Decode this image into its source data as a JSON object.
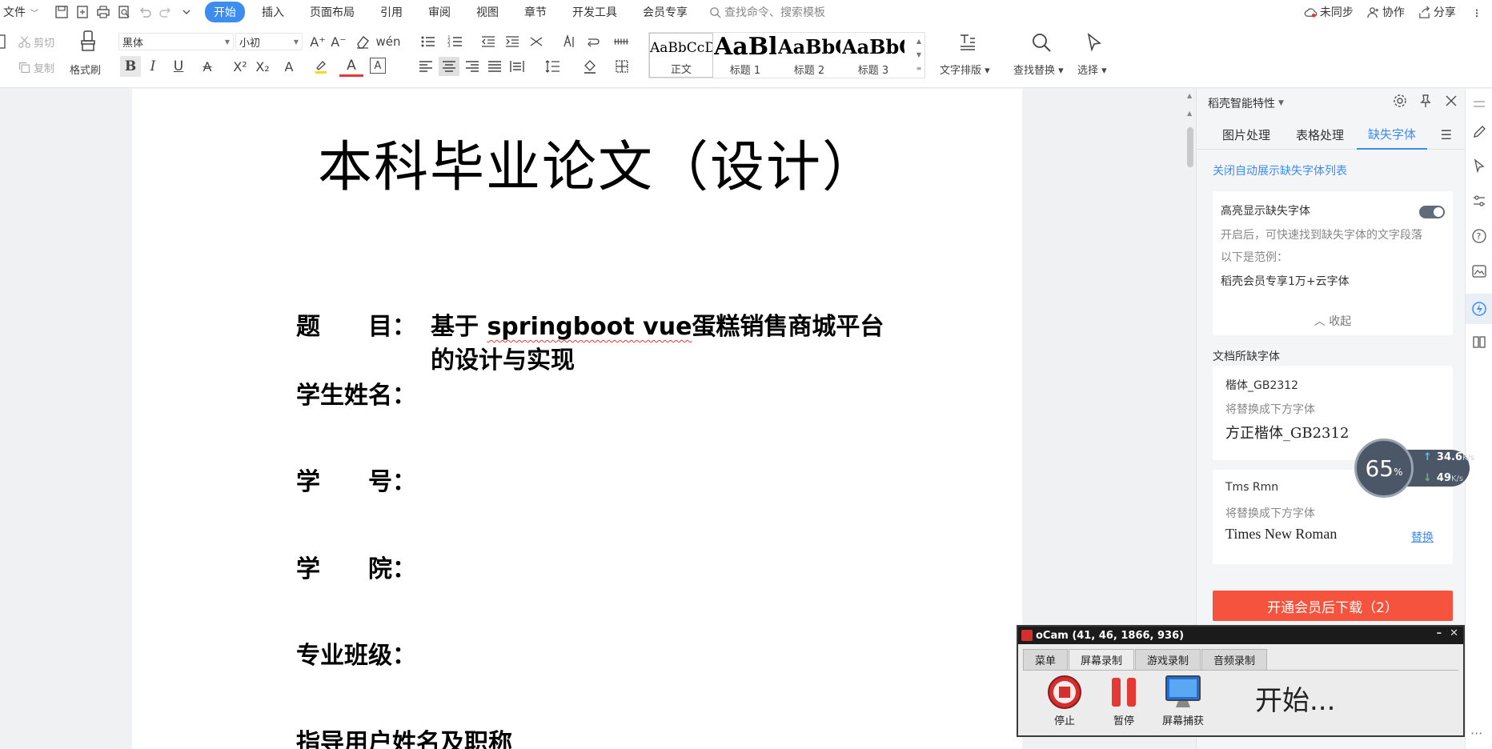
{
  "menubar": {
    "file_label": "文件",
    "tabs": [
      {
        "label": "开始",
        "active": true
      },
      {
        "label": "插入",
        "active": false
      },
      {
        "label": "页面布局",
        "active": false
      },
      {
        "label": "引用",
        "active": false
      },
      {
        "label": "审阅",
        "active": false
      },
      {
        "label": "视图",
        "active": false
      },
      {
        "label": "章节",
        "active": false
      },
      {
        "label": "开发工具",
        "active": false
      },
      {
        "label": "会员专享",
        "active": false
      }
    ],
    "search_placeholder": "查找命令、搜索模板",
    "right": {
      "sync": "未同步",
      "collab": "协作",
      "share": "分享"
    }
  },
  "ribbon": {
    "cut": "剪切",
    "copy": "复制",
    "format_painter": "格式刷",
    "font_name": "黑体",
    "font_size": "小初",
    "styles": [
      {
        "preview": "AaBbCcDd",
        "label": "正文"
      },
      {
        "preview": "AaBl",
        "label": "标题 1"
      },
      {
        "preview": "AaBbC",
        "label": "标题 2"
      },
      {
        "preview": "AaBbC",
        "label": "标题 3"
      }
    ],
    "text_layout": "文字排版",
    "find_replace": "查找替换",
    "select": "选择"
  },
  "document": {
    "title": "本科毕业论文（设计）",
    "fields": [
      {
        "label": "题　　目：",
        "value": "基于",
        "value_spell": "springboot vue",
        "value_rest": "蛋糕销售商城平台",
        "value_line2": "的设计与实现"
      },
      {
        "label": "学生姓名："
      },
      {
        "label": "学　　号："
      },
      {
        "label": "学　　院："
      },
      {
        "label": "专业班级："
      },
      {
        "label": "指导用户姓名及职称"
      }
    ]
  },
  "panel": {
    "title": "稻壳智能特性",
    "tabs": [
      "图片处理",
      "表格处理",
      "缺失字体"
    ],
    "active_tab": "缺失字体",
    "close_auto_link": "关闭自动展示缺失字体列表",
    "highlight": {
      "title": "高亮显示缺失字体",
      "desc": "开启后，可快速找到缺失字体的文字段落",
      "example_label": "以下是范例：",
      "example": "稻壳会员专享1万+云字体",
      "collapse": "收起"
    },
    "missing_title": "文档所缺字体",
    "fonts": [
      {
        "name": "楷体_GB2312",
        "hint": "将替换成下方字体",
        "replacement": "方正楷体_GB2312",
        "action": ""
      },
      {
        "name": "Tms Rmn",
        "hint": "将替换成下方字体",
        "replacement": "Times New Roman",
        "action": "替换"
      }
    ],
    "download_btn": "开通会员后下载（2）"
  },
  "speed_widget": {
    "percent": "65",
    "percent_unit": "%",
    "up": "34.6",
    "down": "49",
    "unit": "K/s"
  },
  "ocam": {
    "title": "oCam (41, 46, 1866, 936)",
    "tabs": [
      "菜单",
      "屏幕录制",
      "游戏录制",
      "音频录制"
    ],
    "active_tab": "屏幕录制",
    "buttons": {
      "stop": "停止",
      "pause": "暂停",
      "capture": "屏幕捕获"
    },
    "status": "开始..."
  },
  "colors": {
    "accent": "#3d8cf0",
    "download": "#f5533d"
  }
}
